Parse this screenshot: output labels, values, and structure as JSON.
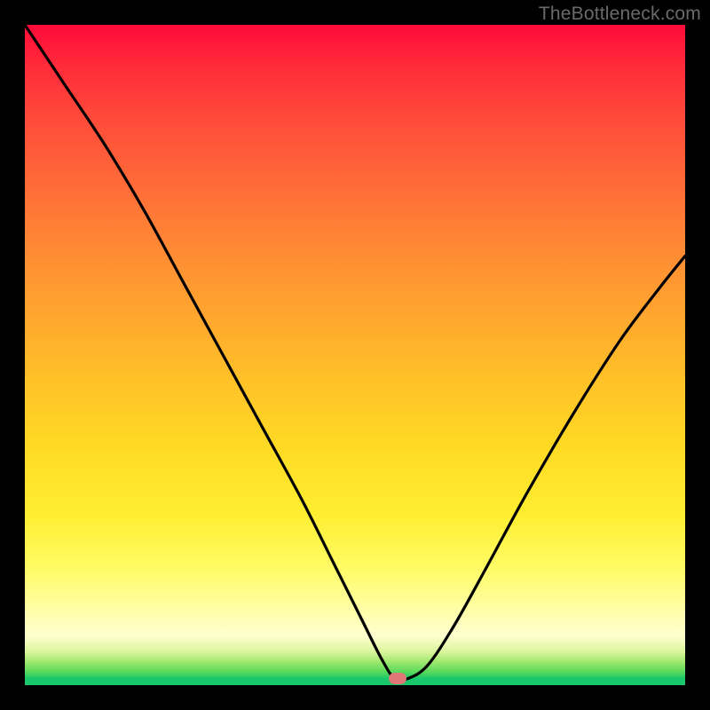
{
  "watermark": "TheBottleneck.com",
  "marker": {
    "x_frac": 0.565,
    "y_frac": 0.989,
    "color": "#e07878"
  },
  "chart_data": {
    "type": "line",
    "title": "",
    "xlabel": "",
    "ylabel": "",
    "xlim": [
      0,
      1
    ],
    "ylim": [
      0,
      1
    ],
    "series": [
      {
        "name": "bottleneck-curve",
        "x": [
          0.0,
          0.06,
          0.12,
          0.18,
          0.24,
          0.3,
          0.36,
          0.42,
          0.47,
          0.51,
          0.54,
          0.56,
          0.58,
          0.61,
          0.65,
          0.7,
          0.76,
          0.83,
          0.9,
          0.96,
          1.0
        ],
        "y": [
          1.0,
          0.91,
          0.82,
          0.72,
          0.61,
          0.5,
          0.39,
          0.28,
          0.18,
          0.1,
          0.04,
          0.01,
          0.01,
          0.03,
          0.09,
          0.18,
          0.29,
          0.41,
          0.52,
          0.6,
          0.65
        ]
      }
    ],
    "annotations": [
      {
        "text": "TheBottleneck.com",
        "role": "watermark",
        "position": "top-right"
      }
    ],
    "background_gradient_stops": [
      {
        "pos": 0.0,
        "color": "#ff0a3a"
      },
      {
        "pos": 0.5,
        "color": "#ffb82a"
      },
      {
        "pos": 0.85,
        "color": "#fffb63"
      },
      {
        "pos": 0.95,
        "color": "#9ee86e"
      },
      {
        "pos": 1.0,
        "color": "#18c86a"
      }
    ]
  }
}
